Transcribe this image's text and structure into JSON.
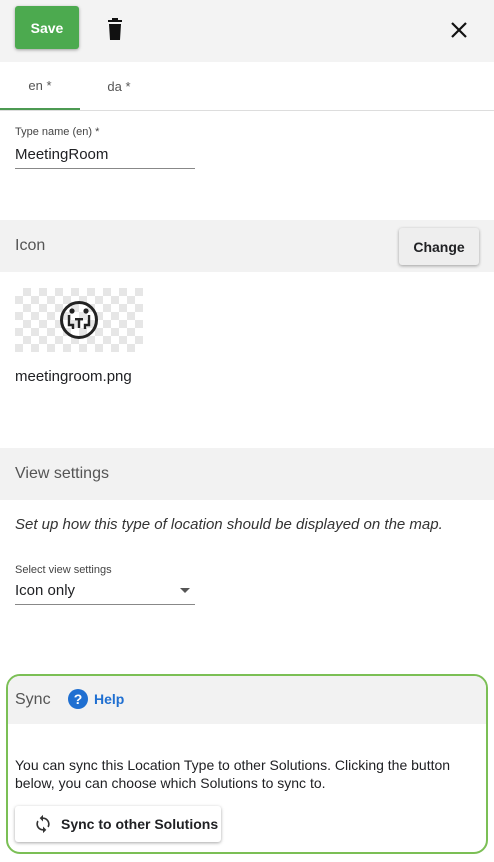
{
  "toolbar": {
    "save_label": "Save"
  },
  "tabs": [
    {
      "label": "en *",
      "active": true
    },
    {
      "label": "da *",
      "active": false
    }
  ],
  "type_name": {
    "label": "Type name (en) *",
    "value": "MeetingRoom"
  },
  "icon_section": {
    "title": "Icon",
    "change_label": "Change",
    "file_name": "meetingroom.png",
    "icon": "meeting-room-icon"
  },
  "view_settings": {
    "title": "View settings",
    "description": "Set up how this type of location should be displayed on the map.",
    "select_label": "Select view settings",
    "select_value": "Icon only"
  },
  "sync": {
    "title": "Sync",
    "help_label": "Help",
    "description": "You can sync this Location Type to other Solutions. Clicking the button below, you can choose which Solutions to sync to.",
    "button_label": "Sync to other Solutions"
  },
  "colors": {
    "save": "#4caa4f",
    "tab_indicator": "#4c9a52",
    "sync_border": "#7bbf55",
    "help": "#1f6fd1"
  }
}
